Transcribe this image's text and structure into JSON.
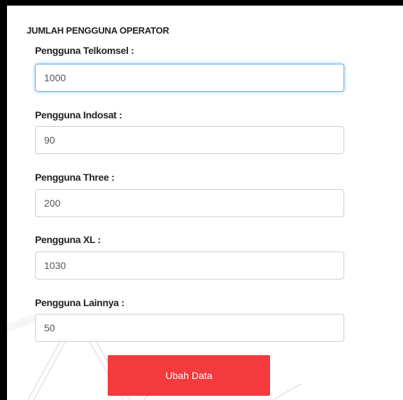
{
  "form": {
    "title": "JUMLAH PENGGUNA OPERATOR",
    "fields": [
      {
        "label": "Pengguna Telkomsel :",
        "value": "1000"
      },
      {
        "label": "Pengguna Indosat :",
        "value": "90"
      },
      {
        "label": "Pengguna Three :",
        "value": "200"
      },
      {
        "label": "Pengguna XL :",
        "value": "1030"
      },
      {
        "label": "Pengguna Lainnya :",
        "value": "50"
      }
    ],
    "submit_label": "Ubah Data"
  },
  "colors": {
    "frame": "#000000",
    "panel": "#ffffff",
    "submit_button": "#f33a3c",
    "focus_ring": "#66afe9",
    "input_border": "#cfcfcf"
  }
}
